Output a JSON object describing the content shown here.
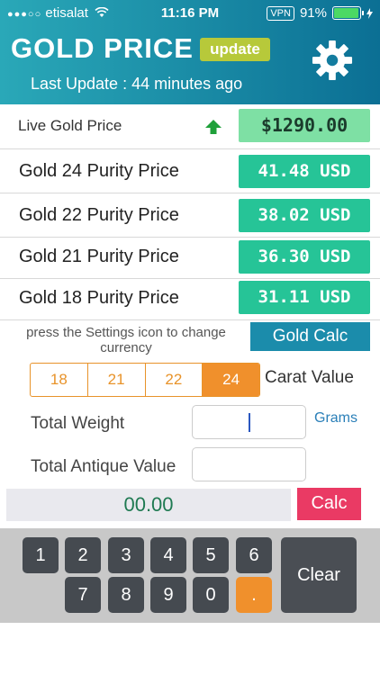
{
  "status_bar": {
    "signal": "●●●○○",
    "carrier": "etisalat",
    "time": "11:16 PM",
    "vpn": "VPN",
    "battery": "91%"
  },
  "header": {
    "title": "GOLD PRICE",
    "update_label": "update",
    "last_update": "Last Update : 44 minutes ago",
    "gear_icon": "gear-icon"
  },
  "live": {
    "label": "Live Gold Price",
    "trend_icon": "arrow-up-icon",
    "value": "$1290.00"
  },
  "prices": [
    {
      "label": "Gold 24 Purity Price",
      "value": "41.48 USD"
    },
    {
      "label": "Gold 22 Purity Price",
      "value": "38.02 USD"
    },
    {
      "label": "Gold 21 Purity Price",
      "value": "36.30 USD"
    },
    {
      "label": "Gold 18 Purity Price",
      "value": "31.11 USD"
    }
  ],
  "calculator": {
    "hint": "press the Settings icon to change currency",
    "gold_calc_label": "Gold Calc",
    "carat_options": [
      "18",
      "21",
      "22",
      "24"
    ],
    "carat_selected": "24",
    "carat_label": "Carat Value",
    "total_weight_label": "Total Weight",
    "grams_label": "Grams",
    "antique_label": "Total Antique Value",
    "result": "00.00",
    "calc_label": "Calc"
  },
  "keypad": {
    "row1": [
      "1",
      "2",
      "3",
      "4",
      "5",
      "6"
    ],
    "row2": [
      "7",
      "8",
      "9",
      "0",
      "."
    ],
    "clear_label": "Clear"
  },
  "colors": {
    "header_start": "#2aa8b8",
    "header_end": "#0b6f94",
    "price_green": "#26c497",
    "live_green": "#7ee0a4",
    "accent_orange": "#f0902c",
    "calc_red": "#ea3a64",
    "update_olive": "#b7c93a"
  }
}
